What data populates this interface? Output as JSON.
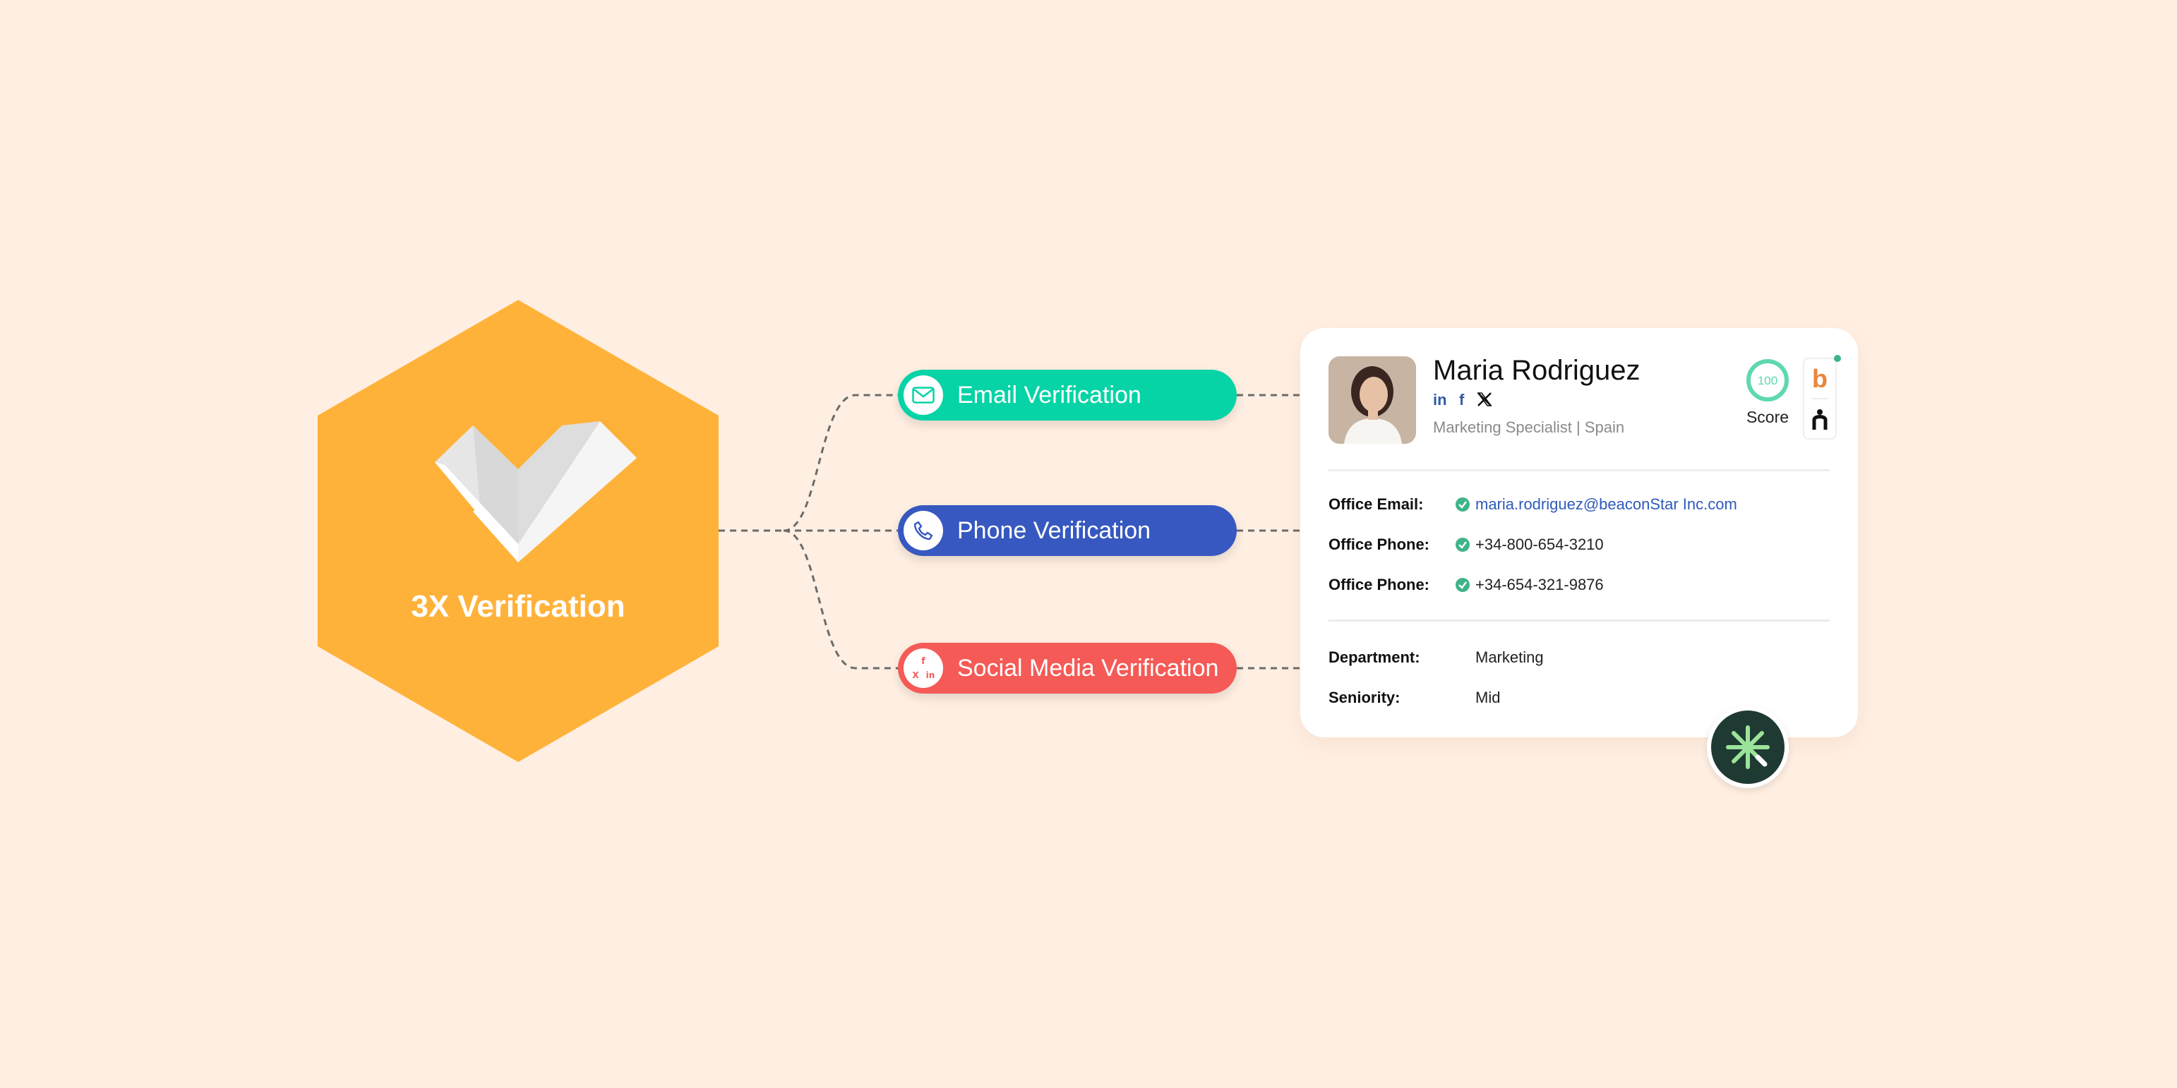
{
  "hexagon": {
    "title": "3X Verification",
    "color": "#FFB23A"
  },
  "verifications": [
    {
      "label": "Email Verification",
      "color": "#06D3A6",
      "icon": "envelope-icon"
    },
    {
      "label": "Phone Verification",
      "color": "#3658C0",
      "icon": "phone-icon"
    },
    {
      "label": "Social Media Verification",
      "color": "#F55A56",
      "icon": "social-media-icon"
    }
  ],
  "profile": {
    "name": "Maria Rodriguez",
    "subtitle": "Marketing Specialist | Spain",
    "social_icons": [
      "linkedin-icon",
      "facebook-icon",
      "x-icon"
    ],
    "score": "100",
    "score_label": "Score",
    "contacts": [
      {
        "label": "Office Email:",
        "value": "maria.rodriguez@beaconStar Inc.com"
      },
      {
        "label": "Office Phone:",
        "value": "+34-800-654-3210"
      },
      {
        "label": "Office Phone:",
        "value": "+34-654-321-9876"
      }
    ],
    "details": [
      {
        "label": "Department:",
        "value": "Marketing"
      },
      {
        "label": "Seniority:",
        "value": "Mid"
      }
    ]
  },
  "colors": {
    "background": "#FFEFE2",
    "verified_check": "#3FB489",
    "link": "#2F5BB8",
    "badge_dark": "#1F3A32",
    "badge_accent": "#9BE39A"
  }
}
